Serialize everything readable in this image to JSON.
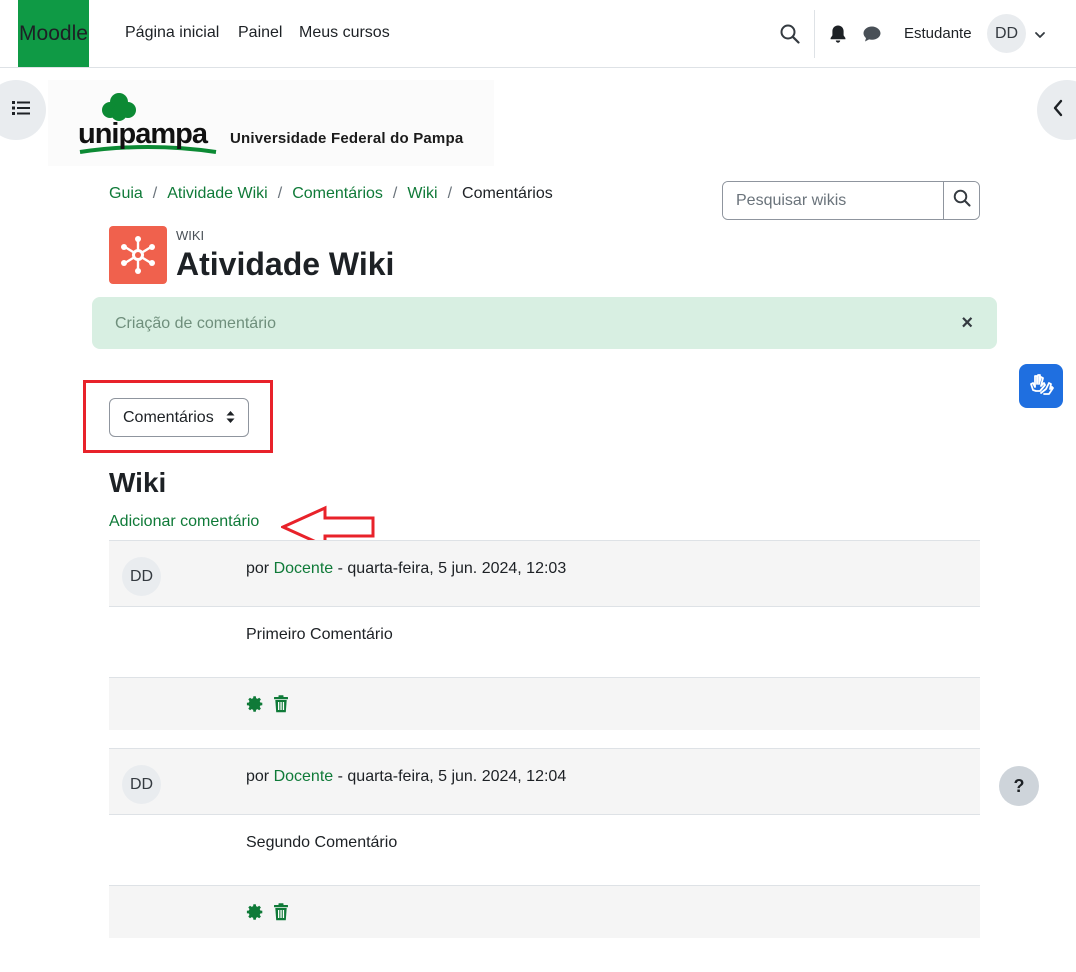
{
  "navbar": {
    "logo": "Moodle",
    "links": [
      "Página inicial",
      "Painel",
      "Meus cursos"
    ],
    "user_name": "Estudante",
    "avatar_initials": "DD",
    "icons": [
      "search-icon",
      "bell-icon",
      "chat-icon",
      "chevron-down-icon"
    ]
  },
  "banner": {
    "logo_text": "unipampa",
    "institution": "Universidade Federal do Pampa"
  },
  "breadcrumb": [
    "Guia",
    "Atividade Wiki",
    "Comentários",
    "Wiki",
    "Comentários"
  ],
  "search": {
    "placeholder": "Pesquisar wikis"
  },
  "activity": {
    "type": "WIKI",
    "title": "Atividade Wiki"
  },
  "alert": {
    "text": "Criação de comentário",
    "close": "×"
  },
  "select": {
    "value": "Comentários"
  },
  "section": {
    "heading": "Wiki",
    "add_comment": "Adicionar comentário"
  },
  "comments": [
    {
      "avatar": "DD",
      "prefix": "por",
      "author": "Docente",
      "date": " - quarta-feira, 5 jun. 2024, 12:03",
      "text": "Primeiro Comentário"
    },
    {
      "avatar": "DD",
      "prefix": "por",
      "author": "Docente",
      "date": " - quarta-feira, 5 jun. 2024, 12:04",
      "text": "Segundo Comentário"
    }
  ],
  "help": {
    "label": "?"
  },
  "colors": {
    "brand": "#0f9a45",
    "link": "#0f7a38",
    "alert_bg": "#d8efe2",
    "highlight": "#e8222a",
    "activity_icon": "#f0614d"
  }
}
